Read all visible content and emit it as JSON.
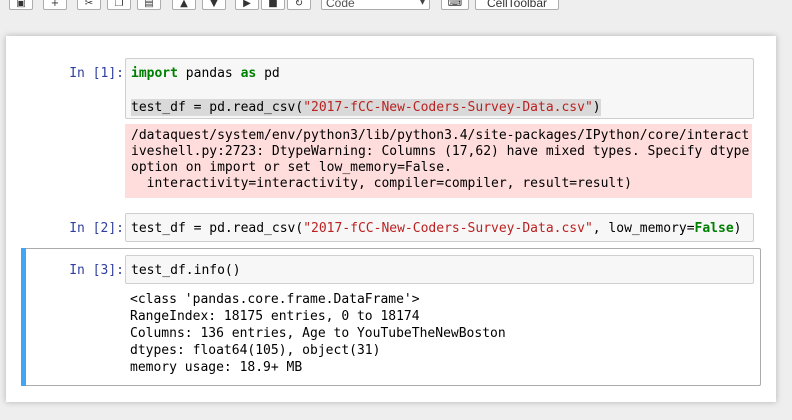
{
  "toolbar": {
    "cell_type_selected": "Code",
    "celltoolbar_label": "CellToolbar"
  },
  "cells": [
    {
      "prompt": "In [1]:",
      "code_line1_kw1": "import",
      "code_line1_mid": " pandas ",
      "code_line1_kw2": "as",
      "code_line1_end": " pd",
      "code_line2_pre": "test_df = pd.read_csv(",
      "code_line2_str": "\"2017-fCC-New-Coders-Survey-Data.csv\"",
      "code_line2_end": ")",
      "stderr": "/dataquest/system/env/python3/lib/python3.4/site-packages/IPython/core/interact\niveshell.py:2723: DtypeWarning: Columns (17,62) have mixed types. Specify dtype\noption on import or set low_memory=False.\n  interactivity=interactivity, compiler=compiler, result=result)"
    },
    {
      "prompt": "In [2]:",
      "code_pre": "test_df = pd.read_csv(",
      "code_str": "\"2017-fCC-New-Coders-Survey-Data.csv\"",
      "code_mid": ", low_memory=",
      "code_kw": "False",
      "code_end": ")"
    },
    {
      "prompt": "In [3]:",
      "code": "test_df.info()",
      "output": "<class 'pandas.core.frame.DataFrame'>\nRangeIndex: 18175 entries, 0 to 18174\nColumns: 136 entries, Age to YouTubeTheNewBoston\ndtypes: float64(105), object(31)\nmemory usage: 18.9+ MB"
    }
  ],
  "colors": {
    "prompt": "#303f9f",
    "keyword": "#008000",
    "string": "#ba2121",
    "stderr_bg": "#ffdddd",
    "selected_bar": "#42a5f5"
  }
}
